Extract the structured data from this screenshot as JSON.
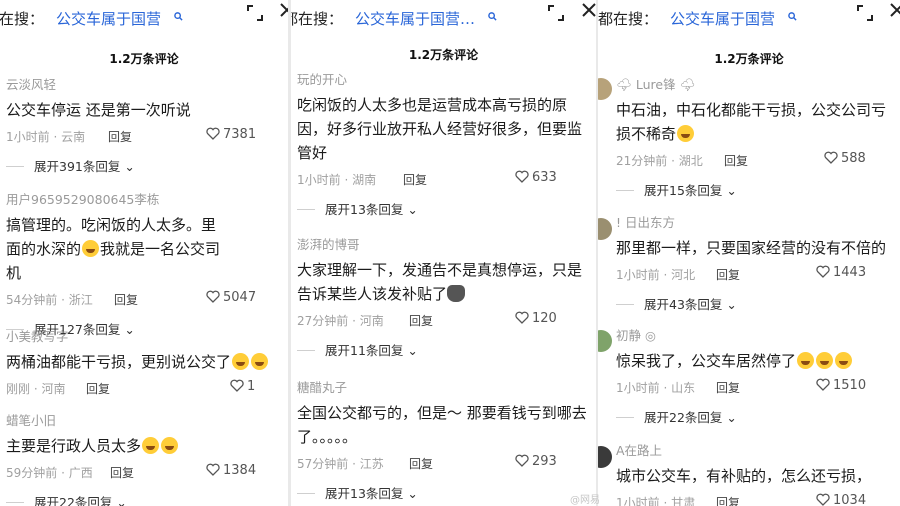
{
  "search": {
    "prefix_1": "都在搜：",
    "prefix_2": "都在搜：",
    "prefix_3": "大家都在搜：",
    "query_1": "公交车属于国营",
    "query_2": "公交车属于国营…",
    "query_3": "公交车属于国营"
  },
  "comment_count": "1.2万条评论",
  "watermark": "@网易",
  "panel1": [
    {
      "user": "云淡风轻",
      "text": "公交车停运 还是第一次听说",
      "time": "1小时前 · 云南",
      "reply": "回复",
      "likes": "7381",
      "expand": "展开391条回复"
    },
    {
      "user": "用户9659529080645李栋",
      "text": "搞管理的。吃闲饭的人太多。里面的水深的",
      "text2": "我就是一名公交司机",
      "time": "54分钟前 · 浙江",
      "reply": "回复",
      "likes": "5047",
      "expand": "展开127条回复"
    },
    {
      "user": "小美教写字",
      "text": "两桶油都能干亏损，更别说公交了",
      "time": "刚刚 · 河南",
      "reply": "回复",
      "likes": "1",
      "expand": ""
    },
    {
      "user": "蜡笔小旧",
      "text": "主要是行政人员太多",
      "time": "59分钟前 · 广西",
      "reply": "回复",
      "likes": "1384",
      "expand": "展开22条回复"
    }
  ],
  "panel2": [
    {
      "user": "玩的开心",
      "text": "吃闲饭的人太多也是运营成本高亏损的原因，好多行业放开私人经营好很多，但要监管好",
      "time": "1小时前 · 湖南",
      "reply": "回复",
      "likes": "633",
      "expand": "展开13条回复"
    },
    {
      "user": "澎湃的博哥",
      "text": "大家理解一下，发通告不是真想停运，只是告诉某些人该发补贴了",
      "time": "27分钟前 · 河南",
      "reply": "回复",
      "likes": "120",
      "expand": "展开11条回复"
    },
    {
      "user": "糖醋丸子",
      "text": "全国公交都亏的，但是～ 那要看钱亏到哪去了。。。。。",
      "time": "57分钟前 · 江苏",
      "reply": "回复",
      "likes": "293",
      "expand": "展开13条回复"
    }
  ],
  "panel3": [
    {
      "user": "Lure锋",
      "text": "中石油，中石化都能干亏损，公交公司亏损不稀奇",
      "time": "21分钟前 · 湖北",
      "reply": "回复",
      "likes": "588",
      "expand": "展开15条回复"
    },
    {
      "user": "日出东方",
      "text": "那里都一样，只要国家经营的没有不倍的",
      "time": "1小时前 · 河北",
      "reply": "回复",
      "likes": "1443",
      "expand": "展开43条回复"
    },
    {
      "user": "初静",
      "text": "惊呆我了，公交车居然停了",
      "time": "1小时前 · 山东",
      "reply": "回复",
      "likes": "1510",
      "expand": "展开22条回复"
    },
    {
      "user": "A在路上",
      "text": "城市公交车，有补贴的，怎么还亏损，",
      "time": "1小时前 · 甘肃",
      "reply": "回复",
      "likes": "1034",
      "expand": ""
    }
  ]
}
